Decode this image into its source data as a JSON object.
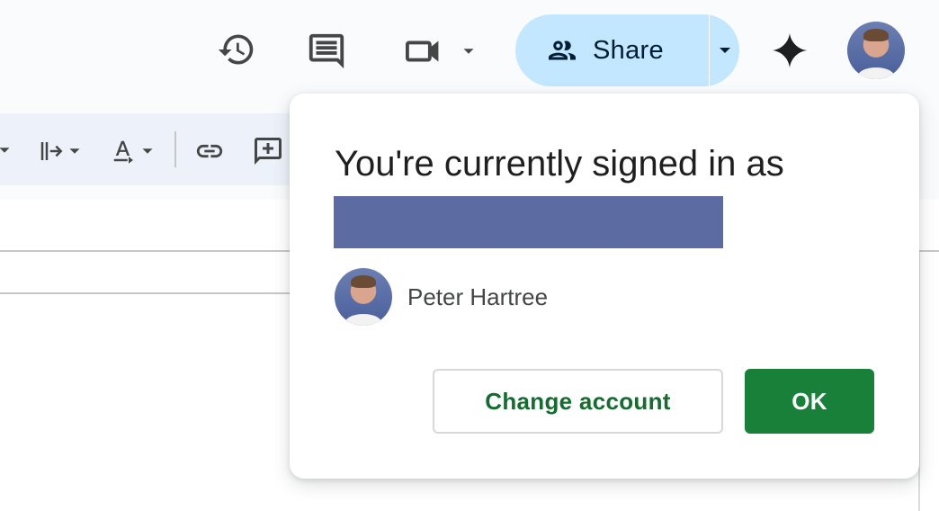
{
  "header": {
    "share_label": "Share",
    "icons": [
      "history-icon",
      "comments-icon",
      "video-call-icon",
      "people-icon",
      "gemini-icon"
    ]
  },
  "dialog": {
    "title": "You're currently signed in as",
    "account_name": "Peter Hartree",
    "change_account_label": "Change account",
    "ok_label": "OK"
  },
  "colors": {
    "share_bg": "#c2e7ff",
    "ok_bg": "#188038",
    "change_account_text": "#146c2e",
    "redaction": "#5d6ba3"
  }
}
